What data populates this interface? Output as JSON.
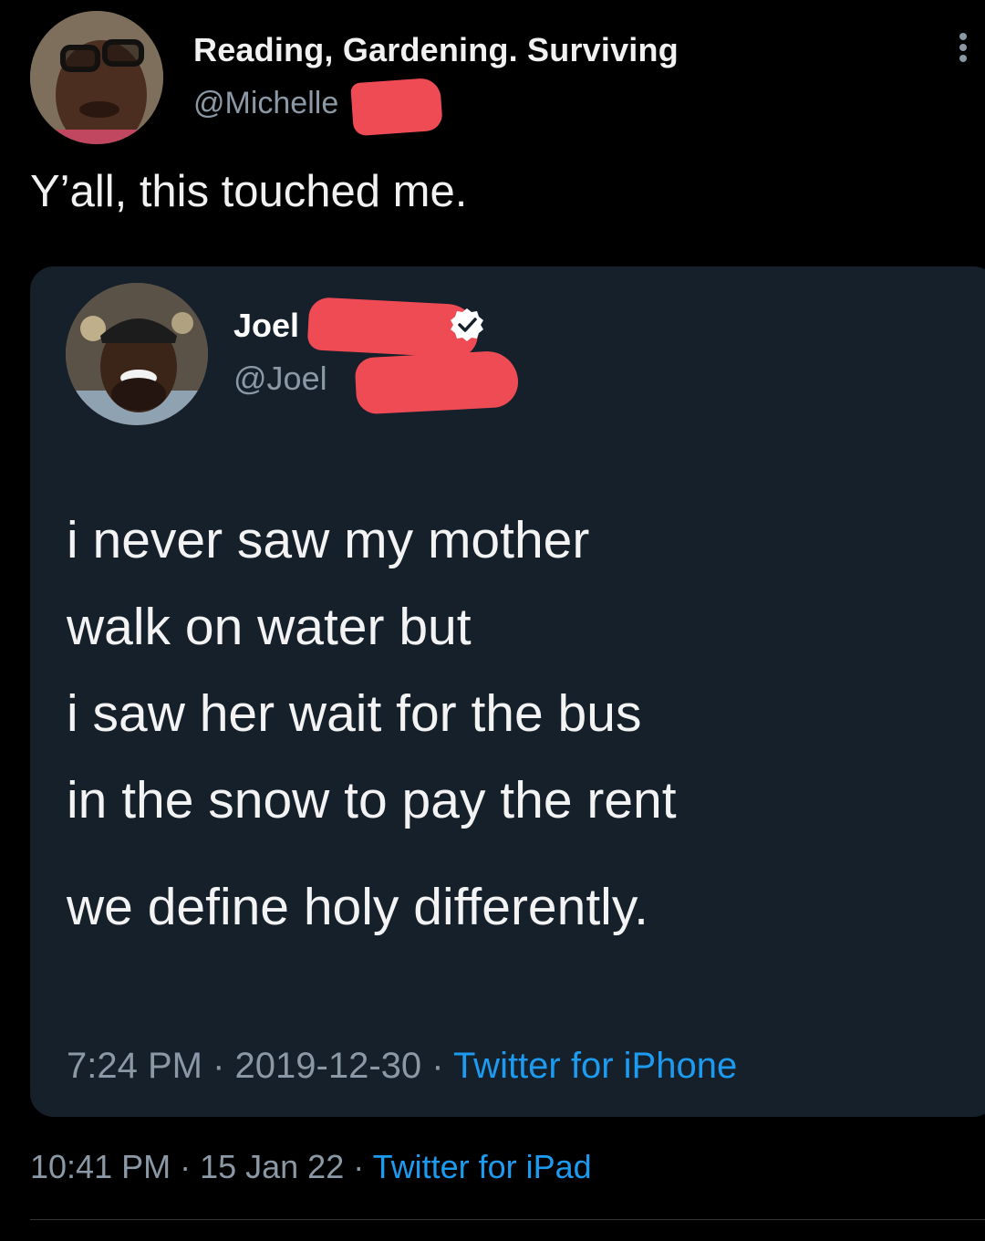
{
  "tweet": {
    "author": {
      "display_name": "Reading, Gardening. Surviving",
      "handle": "@Michelle"
    },
    "text": "Y’all, this touched me.",
    "meta": {
      "time": "10:41 PM",
      "date": "15 Jan 22",
      "source": "Twitter for iPad"
    }
  },
  "quoted_tweet": {
    "author": {
      "display_name": "Joel",
      "handle": "@Joel"
    },
    "lines": [
      "i never saw my mother",
      "walk on water but",
      "i saw her wait for the bus",
      "in the snow to pay the rent",
      "we define holy differently."
    ],
    "meta": {
      "time": "7:24 PM",
      "date": "2019-12-30",
      "source": "Twitter for iPhone"
    }
  },
  "separator": " · ",
  "colors": {
    "background": "#000000",
    "card": "#15202b",
    "link": "#1d9bf0",
    "muted": "#8b98a5",
    "redaction": "#ef4b55"
  },
  "icons": [
    "more-icon",
    "verified-badge-icon"
  ]
}
